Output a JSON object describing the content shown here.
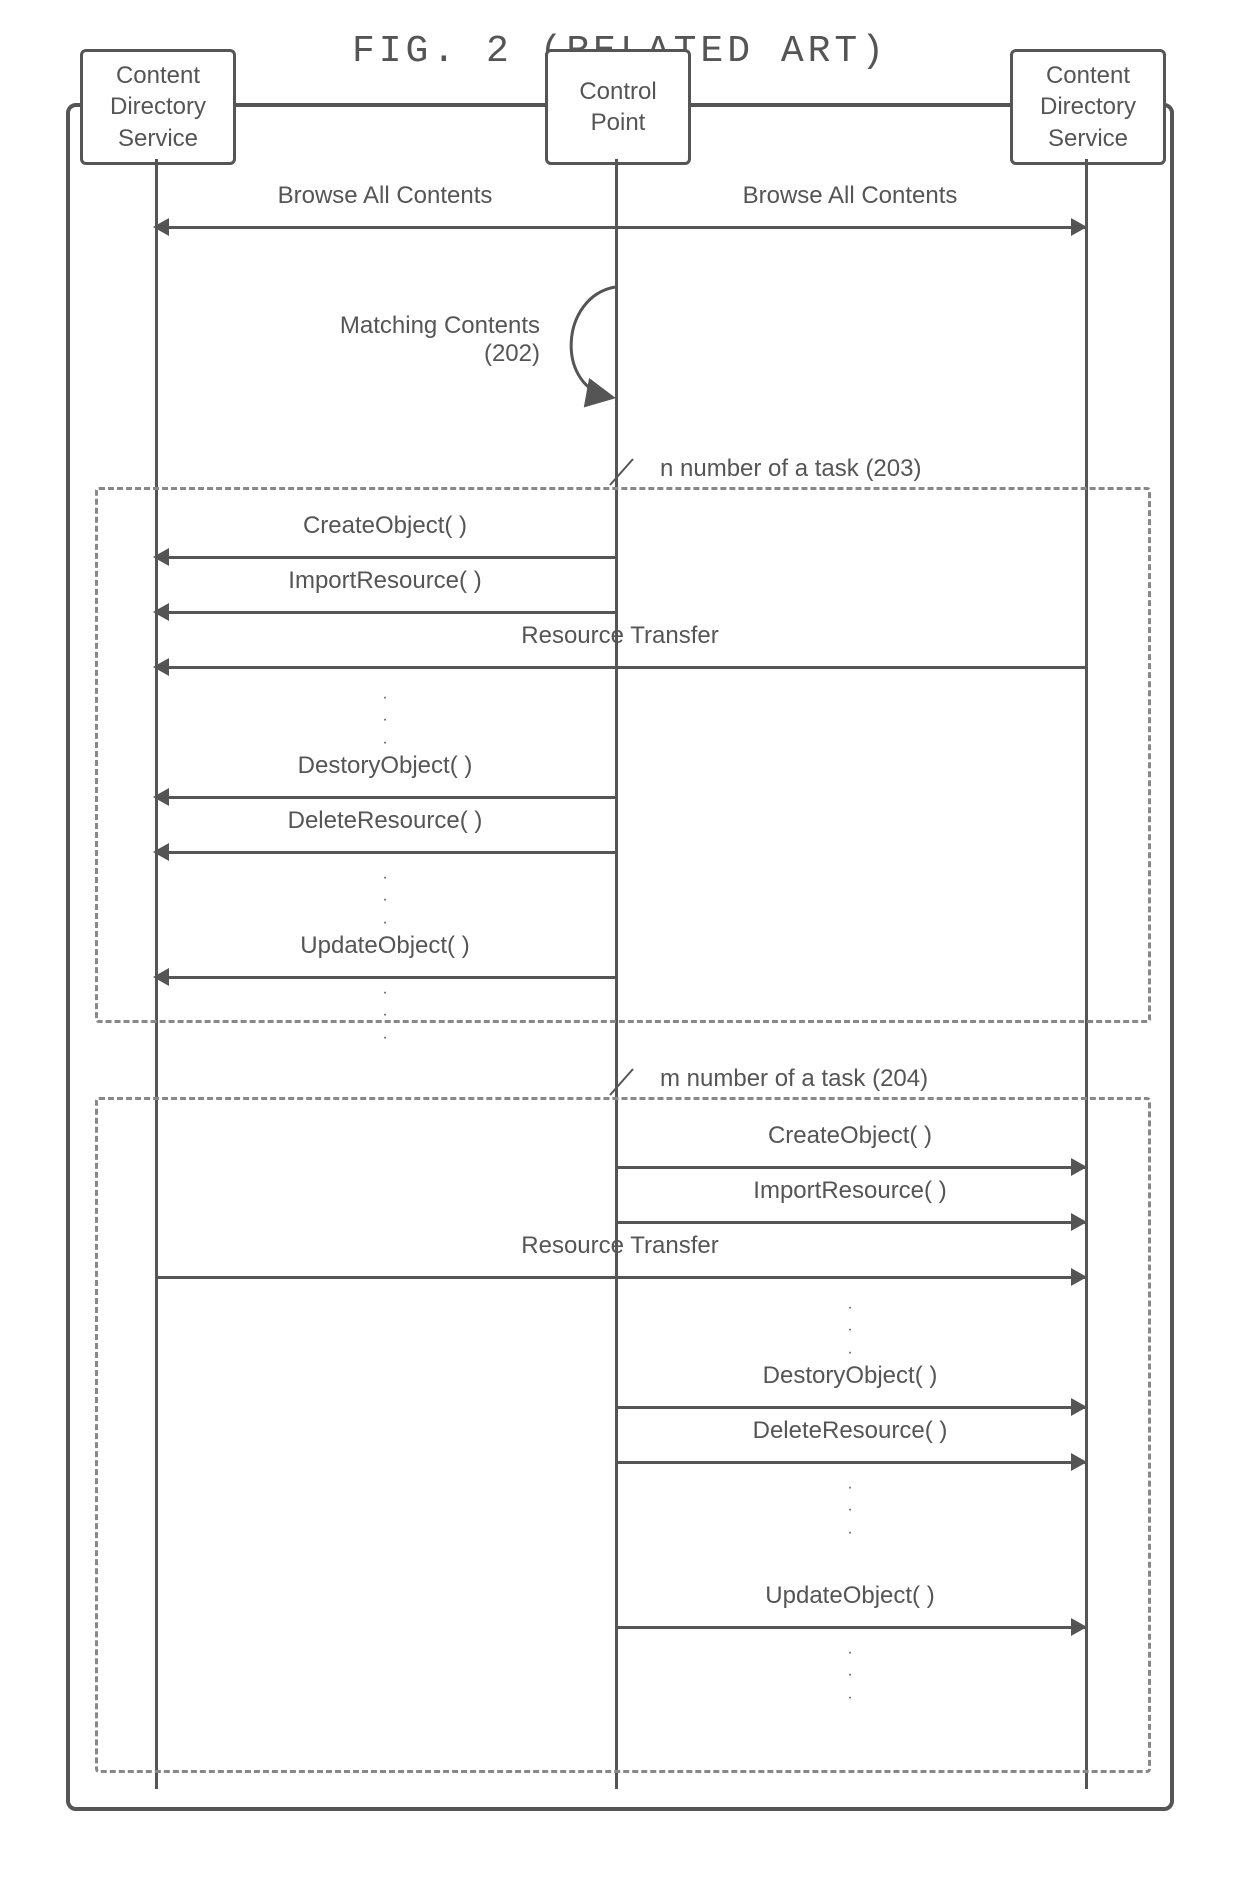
{
  "title": "FIG. 2 (RELATED ART)",
  "actors": {
    "left": "Content\nDirectory\nService",
    "center": "Control\nPoint",
    "right": "Content\nDirectory\nService"
  },
  "messages": {
    "browse_left": "Browse All Contents",
    "browse_right": "Browse All Contents",
    "matching_contents_line1": "Matching Contents",
    "matching_contents_line2": "(202)",
    "task_n_label": "n number of a task (203)",
    "task_m_label": "m number of a task (204)",
    "create_object": "CreateObject( )",
    "import_resource": "ImportResource( )",
    "resource_transfer": "Resource Transfer",
    "destroy_object": "DestoryObject( )",
    "delete_resource": "DeleteResource( )",
    "update_object": "UpdateObject( )"
  }
}
